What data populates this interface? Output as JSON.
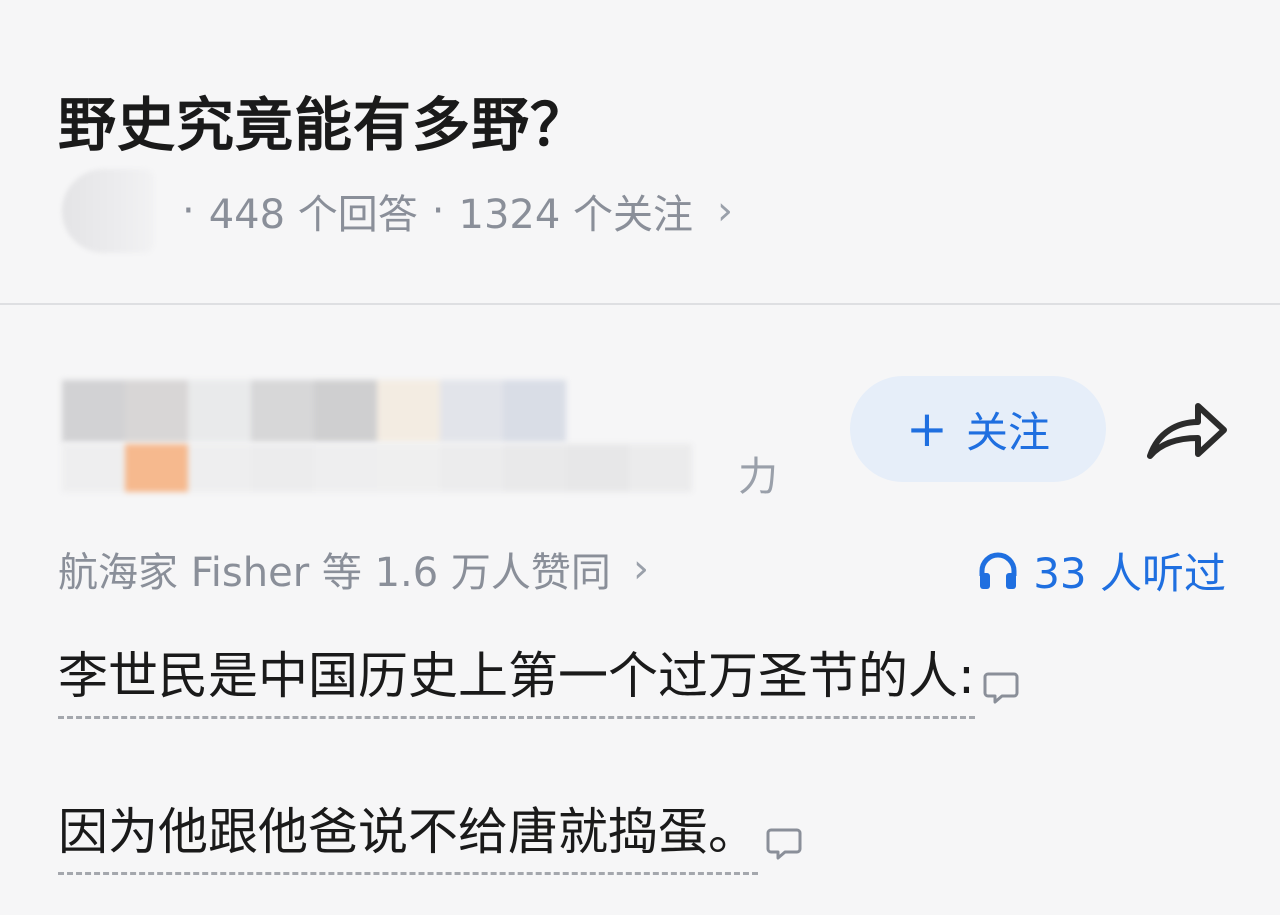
{
  "question": {
    "title": "野史究竟能有多野？",
    "answer_count": "448 个回答",
    "follower_count": "1324 个关注",
    "separator": "·",
    "chevron": "›"
  },
  "answer": {
    "author_suffix": "力",
    "follow_button": {
      "plus": "+",
      "label": "关注"
    },
    "share_icon": "share-arrow-icon",
    "approval_text": "航海家 Fisher 等 1.6 万人赞同",
    "approval_chevron": "›",
    "listen_text": "33 人听过",
    "body_lines": [
      "李世民是中国历史上第一个过万圣节的人:",
      "因为他跟他爸说不给唐就捣蛋。"
    ]
  },
  "colors": {
    "accent": "#1f6fe0",
    "follow_bg": "#e6eef9",
    "muted_text": "#8a8f99",
    "title_text": "#1a1a1a",
    "background": "#f6f6f7"
  }
}
